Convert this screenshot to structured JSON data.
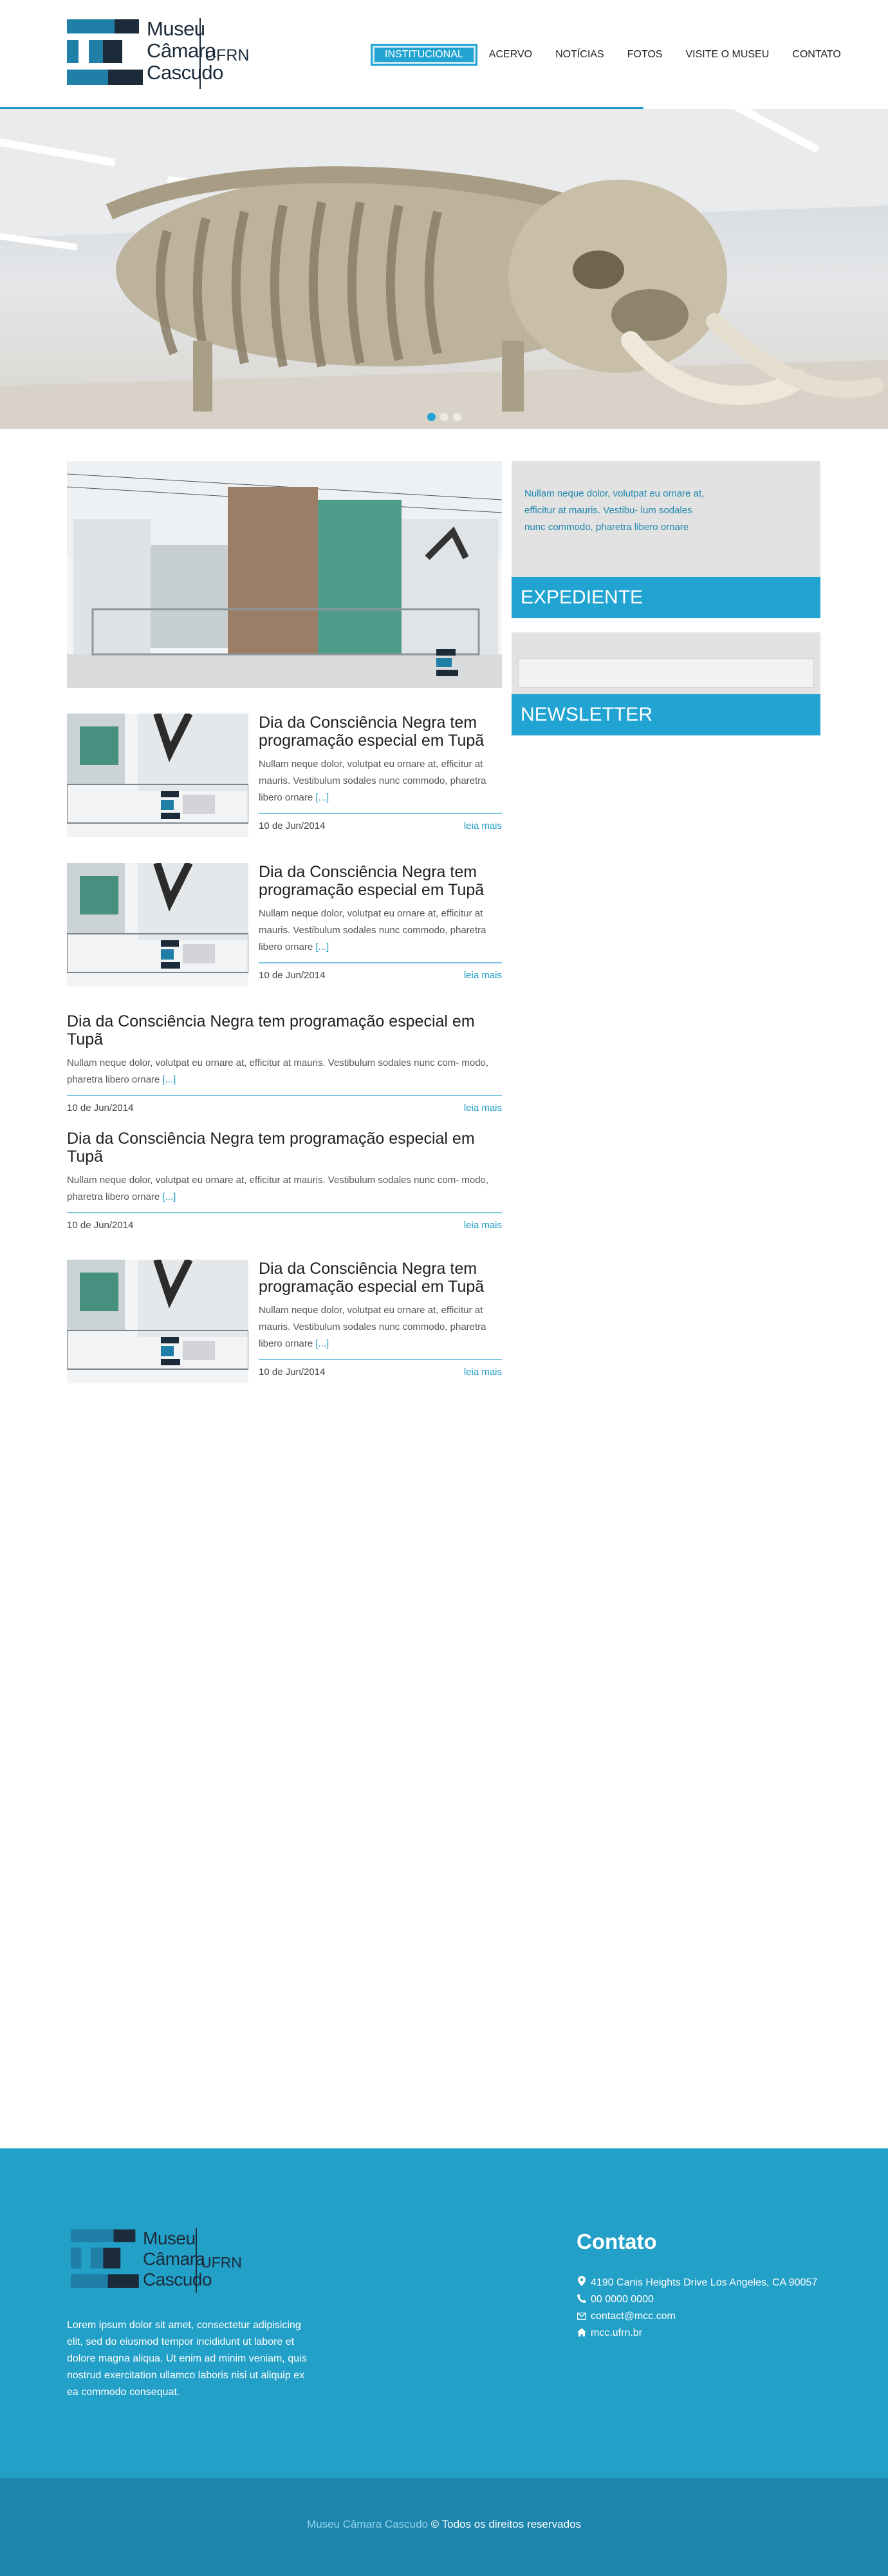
{
  "logo": {
    "line1": "Museu",
    "line2": "Câmara",
    "line3": "Cascudo",
    "suffix": "UFRN"
  },
  "nav": [
    {
      "label": "INSTITUCIONAL",
      "active": true
    },
    {
      "label": "ACERVO",
      "active": false
    },
    {
      "label": "NOTÍCIAS",
      "active": false
    },
    {
      "label": "FOTOS",
      "active": false
    },
    {
      "label": "VISITE O MUSEU",
      "active": false
    },
    {
      "label": "CONTATO",
      "active": false
    }
  ],
  "hero": {
    "slides": 3,
    "active_slide": 1
  },
  "posts": [
    {
      "title": "Dia da Consciência Negra tem programação especial em Tupã",
      "excerpt": "Nullam neque dolor, volutpat eu ornare at, efficitur at mauris. Vestibulum sodales nunc commodo, pharetra libero ornare",
      "more": "[...]",
      "date": "10 de Jun/2014",
      "read_more": "leia mais"
    },
    {
      "title": "Dia da Consciência Negra tem programação especial em Tupã",
      "excerpt": "Nullam neque dolor, volutpat eu ornare at, efficitur at mauris. Vestibulum sodales nunc commodo, pharetra libero ornare",
      "more": "[...]",
      "date": "10 de Jun/2014",
      "read_more": "leia mais"
    },
    {
      "title": "Dia da Consciência Negra tem programação especial em Tupã",
      "excerpt": "Nullam neque dolor, volutpat eu ornare at, efficitur at mauris. Vestibulum sodales nunc com- modo, pharetra libero ornare",
      "more": "[...]",
      "date": "10 de Jun/2014",
      "read_more": "leia mais"
    },
    {
      "title": "Dia da Consciência Negra tem programação especial em Tupã",
      "excerpt": "Nullam neque dolor, volutpat eu ornare at, efficitur at mauris. Vestibulum sodales nunc com- modo, pharetra libero ornare",
      "more": "[...]",
      "date": "10 de Jun/2014",
      "read_more": "leia mais"
    },
    {
      "title": "Dia da Consciência Negra tem programação especial em Tupã",
      "excerpt": "Nullam neque dolor, volutpat eu ornare at, efficitur at mauris. Vestibulum sodales nunc commodo, pharetra libero ornare",
      "more": "[...]",
      "date": "10 de Jun/2014",
      "read_more": "leia mais"
    }
  ],
  "sidebar": {
    "intro": "Nullam neque dolor, volutpat eu ornare at, efficitur at mauris. Vestibu- lum sodales nunc commodo, pharetra libero ornare",
    "expediente_title": "EXPEDIENTE",
    "newsletter_title": "NEWSLETTER"
  },
  "footer": {
    "about": "Lorem ipsum dolor sit amet, consectetur adipisicing elit, sed do eiusmod tempor incididunt ut labore et dolore magna aliqua. Ut enim ad minim veniam, quis nostrud exercitation ullamco laboris nisi ut aliquip ex ea commodo consequat.",
    "contact_title": "Contato",
    "address": "4190 Canis Heights Drive Los Angeles, CA 90057",
    "phone": "00 0000 0000",
    "email": "contact@mcc.com",
    "site": "mcc.ufrn.br",
    "copyright_brand": "Museu Câmara Cascudo",
    "copyright_rest": " © Todos os direitos reservados"
  },
  "colors": {
    "accent": "#22a4d3",
    "footer": "#23a0c8",
    "bottom_bar": "#1e86ad",
    "sidebar_bg": "#e2e2e2"
  },
  "icons": [
    "map-pin-icon",
    "phone-icon",
    "envelope-icon",
    "home-icon"
  ]
}
